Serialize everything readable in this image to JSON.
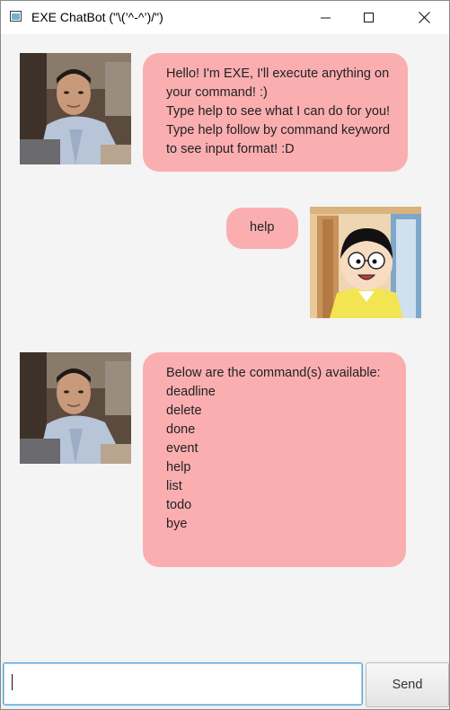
{
  "window": {
    "title": "EXE ChatBot (\"\\(’^-^’)/\")"
  },
  "messages": [
    {
      "sender": "bot",
      "avatar": "photo-of-person-at-desk",
      "lines": [
        "Hello! I'm EXE, I'll execute anything on",
        "your command! :)",
        "Type help to see what I can do for you!",
        "Type help follow by command keyword",
        "to see input format! :D"
      ]
    },
    {
      "sender": "user",
      "avatar": "cartoon-boy-with-glasses",
      "lines": [
        "help"
      ]
    },
    {
      "sender": "bot",
      "avatar": "photo-of-person-at-desk",
      "lines": [
        "Below are the command(s) available:",
        "deadline",
        "delete",
        "done",
        "event",
        "help",
        "list",
        "todo",
        "bye"
      ]
    }
  ],
  "input": {
    "value": "",
    "placeholder": ""
  },
  "send_label": "Send",
  "colors": {
    "bubble": "#fbaeb0",
    "background": "#f4f4f4",
    "input_focus_border": "#52a7d8"
  }
}
